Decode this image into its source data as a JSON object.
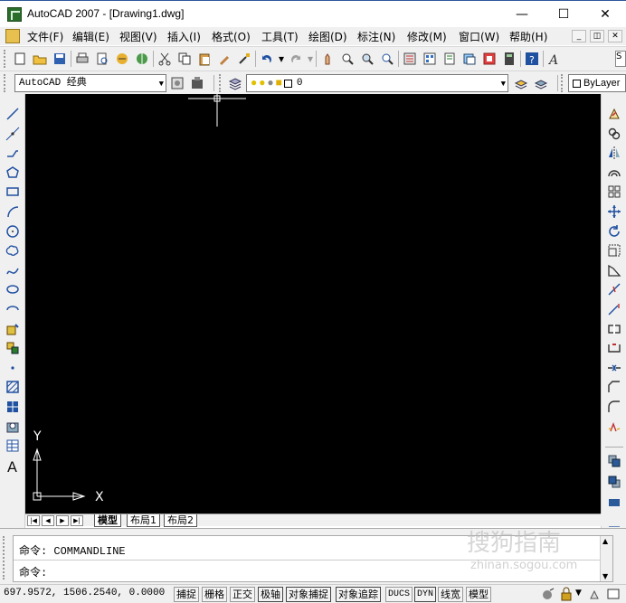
{
  "window": {
    "title": "AutoCAD 2007 - [Drawing1.dwg]"
  },
  "menu": [
    "文件(F)",
    "编辑(E)",
    "视图(V)",
    "插入(I)",
    "格式(O)",
    "工具(T)",
    "绘图(D)",
    "标注(N)",
    "修改(M)",
    "窗口(W)",
    "帮助(H)"
  ],
  "workspace": {
    "value": "AutoCAD 经典"
  },
  "layer": {
    "value": "0"
  },
  "color": {
    "value": "ByLayer"
  },
  "layout_tabs": [
    "模型",
    "布局1",
    "布局2"
  ],
  "command": {
    "history": "命令: COMMANDLINE",
    "prompt": "命令:"
  },
  "status": {
    "coords": "697.9572,  1506.2540,  0.0000",
    "buttons": [
      "捕捉",
      "栅格",
      "正交",
      "极轴",
      "对象捕捉",
      "对象追踪",
      "DUCS",
      "DYN",
      "线宽",
      "模型"
    ]
  },
  "ucs": {
    "x": "X",
    "y": "Y"
  },
  "watermark": {
    "main": "搜狗指南",
    "sub": "zhinan.sogou.com"
  },
  "icons": {
    "draw_tools": [
      "line-icon",
      "construction-line-icon",
      "polyline-icon",
      "polygon-icon",
      "rectangle-icon",
      "arc-icon",
      "circle-icon",
      "revision-cloud-icon",
      "spline-icon",
      "ellipse-icon",
      "ellipse-arc-icon",
      "insert-block-icon",
      "make-block-icon",
      "point-icon",
      "hatch-icon",
      "gradient-icon",
      "region-icon",
      "table-icon",
      "multiline-text-icon"
    ],
    "modify_tools": [
      "erase-icon",
      "copy-icon",
      "mirror-icon",
      "offset-icon",
      "array-icon",
      "move-icon",
      "rotate-icon",
      "scale-icon",
      "stretch-icon",
      "trim-icon",
      "extend-icon",
      "break-at-point-icon",
      "break-icon",
      "join-icon",
      "chamfer-icon",
      "fillet-icon",
      "explode-icon"
    ]
  }
}
